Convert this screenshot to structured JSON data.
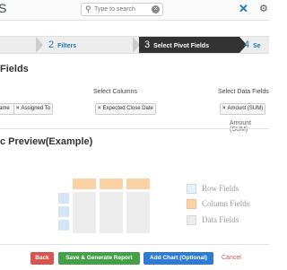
{
  "header": {
    "logo_fragment": "S",
    "search_placeholder": "Type to search",
    "clear_glyph": "×",
    "app_glyph": "✕",
    "settings_glyph": "⚙"
  },
  "wizard": {
    "steps": [
      {
        "number": "",
        "label": ""
      },
      {
        "number": "2",
        "label": "Filters"
      },
      {
        "number": "3",
        "label": "Select Pivot Fields"
      },
      {
        "number": "4",
        "label": "Se"
      }
    ],
    "active_step": 3
  },
  "fields": {
    "section_title": "Fields",
    "rows_chips": [
      "ame",
      "Assigned To"
    ],
    "columns_label": "Select Columns",
    "columns_chips": [
      "Expected Close Date"
    ],
    "data_label": "Select Data Fields",
    "data_chips": [
      "Amount (SUM)"
    ],
    "data_summary": "Amount (SUM)"
  },
  "preview": {
    "title": "c Preview(Example)",
    "legend": {
      "row": "Row Fields",
      "column": "Column Fields",
      "data": "Data Fields"
    }
  },
  "footer": {
    "back": "Back",
    "save": "Save & Generate Report",
    "add_chart": "Add Chart (Optional)",
    "cancel": "Cancel"
  },
  "colors": {
    "accent": "#1a7ab8",
    "active_step": "#333333",
    "back": "#d9534f",
    "save": "#43a047",
    "add_chart": "#2e7bd6",
    "column_field": "#fbd2a6",
    "row_field": "#d4e6f6",
    "data_field": "#ececec"
  }
}
